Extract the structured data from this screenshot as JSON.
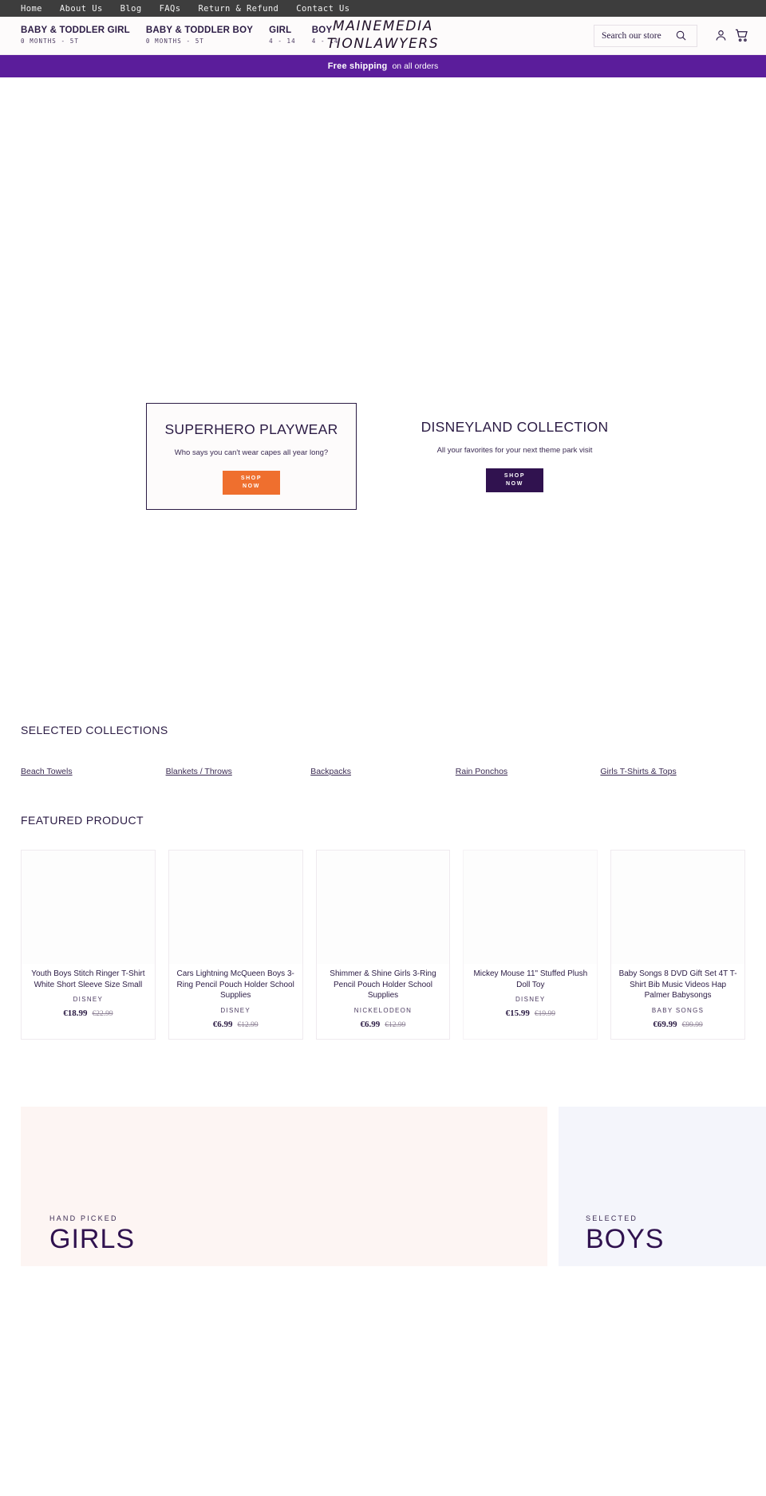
{
  "topbar": {
    "links": [
      {
        "label": "Home"
      },
      {
        "label": "About Us"
      },
      {
        "label": "Blog"
      },
      {
        "label": "FAQs"
      },
      {
        "label": "Return & Refund"
      },
      {
        "label": "Contact Us"
      }
    ]
  },
  "header": {
    "categories": [
      {
        "title": "BABY & TODDLER GIRL",
        "sub": "0 MONTHS - 5T"
      },
      {
        "title": "BABY & TODDLER BOY",
        "sub": "0 MONTHS - 5T"
      },
      {
        "title": "GIRL",
        "sub": "4 - 14"
      },
      {
        "title": "BOY",
        "sub": "4 - 14"
      }
    ],
    "logo_line1": "MAINEMEDIA",
    "logo_line2": "TIONLAWYERS",
    "search_placeholder": "Search our store",
    "search_value": "",
    "search_icon": "search-icon",
    "account_icon": "account-person-icon",
    "cart_icon": "shopping-cart-icon"
  },
  "promo": {
    "strong": "Free shipping",
    "light": "on all orders",
    "background": "#5b1d9b"
  },
  "hero": {
    "cards": [
      {
        "title": "SUPERHERO PLAYWEAR",
        "subtitle": "Who says you can't wear capes all year long?",
        "button_line1": "SHOP",
        "button_line2": "NOW",
        "button_color": "#ef6f2e",
        "bordered": true
      },
      {
        "title": "DISNEYLAND COLLECTION",
        "subtitle": "All your favorites for your next theme park visit",
        "button_line1": "SHOP",
        "button_line2": "NOW",
        "button_color": "#30124f",
        "bordered": false
      }
    ]
  },
  "collections": {
    "heading": "SELECTED COLLECTIONS",
    "items": [
      {
        "label": "Beach Towels"
      },
      {
        "label": "Blankets / Throws"
      },
      {
        "label": "Backpacks"
      },
      {
        "label": "Rain Ponchos"
      },
      {
        "label": "Girls T-Shirts & Tops"
      }
    ]
  },
  "featured": {
    "heading": "FEATURED PRODUCT",
    "products": [
      {
        "title": "Youth Boys Stitch Ringer T-Shirt White Short Sleeve Size Small",
        "vendor": "DISNEY",
        "price": "€18.99",
        "compare_at": "€22.99"
      },
      {
        "title": "Cars Lightning McQueen Boys 3-Ring Pencil Pouch Holder School Supplies",
        "vendor": "DISNEY",
        "price": "€6.99",
        "compare_at": "€12.99"
      },
      {
        "title": "Shimmer & Shine Girls 3-Ring Pencil Pouch Holder School Supplies",
        "vendor": "NICKELODEON",
        "price": "€6.99",
        "compare_at": "€12.99"
      },
      {
        "title": "Mickey Mouse 11\" Stuffed Plush Doll Toy",
        "vendor": "DISNEY",
        "price": "€15.99",
        "compare_at": "€19.99"
      },
      {
        "title": "Baby Songs 8 DVD Gift Set 4T T-Shirt Bib Music Videos Hap Palmer Babysongs",
        "vendor": "BABY SONGS",
        "price": "€69.99",
        "compare_at": "€99.99"
      }
    ]
  },
  "bottom_banners": [
    {
      "eyebrow": "HAND PICKED",
      "title": "GIRLS",
      "background": "#fdf5f3"
    },
    {
      "eyebrow": "SELECTED",
      "title": "BOYS",
      "background": "#f4f5fb"
    }
  ]
}
